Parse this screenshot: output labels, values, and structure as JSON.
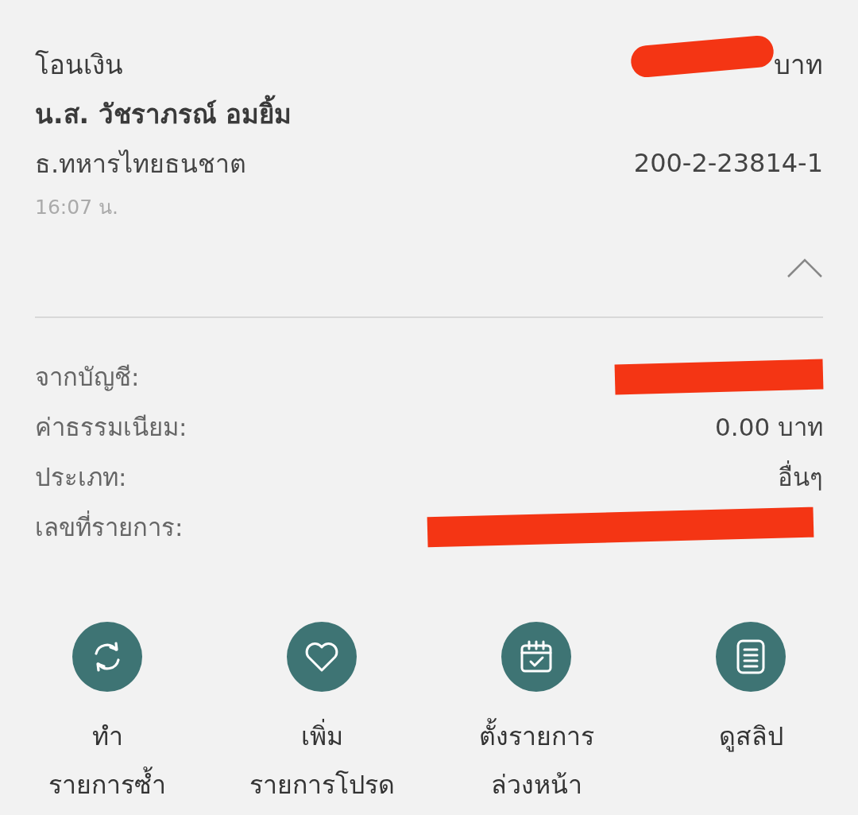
{
  "transfer": {
    "title": "โอนเงิน",
    "amount": {
      "text": "บาท",
      "redacted": true
    },
    "recipient": "น.ส. วัชราภรณ์ อมยิ้ม",
    "bank": "ธ.ทหารไทยธนชาต",
    "account": "200-2-23814-1",
    "time": "16:07 น.",
    "expanded": true
  },
  "details": [
    {
      "label": "จากบัญชี:",
      "redacted": true
    },
    {
      "label": "ค่าธรรมเนียม:",
      "value": "0.00 บาท",
      "redacted": false
    },
    {
      "label": "ประเภท:",
      "value": "อื่นๆ",
      "redacted": false
    },
    {
      "label": "เลขที่รายการ:",
      "redacted": true
    }
  ],
  "actions": [
    {
      "kind": "repeat",
      "lines": [
        "ทำ",
        "รายการซ้ำ"
      ]
    },
    {
      "kind": "favorite",
      "lines": [
        "เพิ่ม",
        "รายการโปรด"
      ]
    },
    {
      "kind": "schedule",
      "lines": [
        "ตั้งรายการ",
        "ล่วงหน้า"
      ]
    },
    {
      "kind": "slip",
      "lines": [
        "ดูสลิป"
      ]
    }
  ]
}
